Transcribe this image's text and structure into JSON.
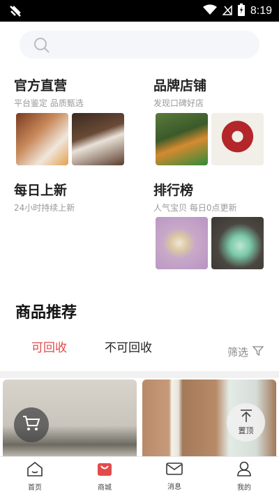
{
  "status_bar": {
    "time": "8:19"
  },
  "search": {
    "placeholder": ""
  },
  "sections": {
    "official": {
      "title": "官方直营",
      "subtitle": "平台鉴定 品质甄选"
    },
    "brand": {
      "title": "品牌店铺",
      "subtitle": "发现口碑好店"
    },
    "daily": {
      "title": "每日上新",
      "subtitle": "24小时持续上新"
    },
    "ranking": {
      "title": "排行榜",
      "subtitle": "人气宝贝 每日0点更新"
    }
  },
  "recommend": {
    "title": "商品推荐",
    "tabs": [
      {
        "label": "可回收"
      },
      {
        "label": "不可回收"
      }
    ],
    "filter_label": "筛选"
  },
  "floating": {
    "top_label": "置顶"
  },
  "bottom_nav": [
    {
      "label": "首页",
      "icon": "home-icon"
    },
    {
      "label": "商城",
      "icon": "shop-bag-icon"
    },
    {
      "label": "消息",
      "icon": "message-icon"
    },
    {
      "label": "我的",
      "icon": "profile-icon"
    }
  ],
  "colors": {
    "accent": "#e24b4b"
  }
}
